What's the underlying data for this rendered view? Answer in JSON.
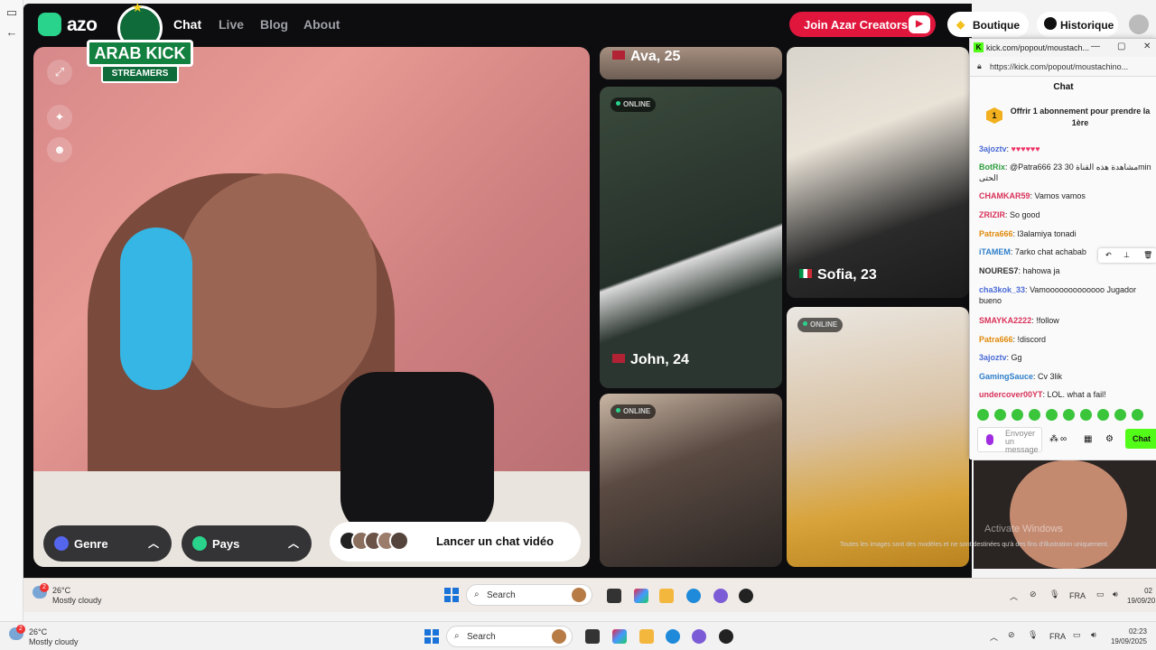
{
  "azar": {
    "logo_text": "azo",
    "nav": [
      "Chat",
      "Live",
      "Blog",
      "About"
    ],
    "join_creators": "Join Azar Creators",
    "boutique": "Boutique",
    "historique": "Historique",
    "watermark_line1": "ARAB KICK",
    "watermark_line2": "STREAMERS",
    "genre": "Genre",
    "pays": "Pays",
    "launch": "Lancer un chat vidéo",
    "online_label": "ONLINE",
    "cards": [
      {
        "name": "Ava, 25"
      },
      {
        "name": "John, 24"
      },
      {
        "name": "Sofia, 23"
      }
    ],
    "disclaimer": "Toutes les images sont des modèles et ne sont destinées qu'à des fins d'illustration uniquement."
  },
  "kick": {
    "window_title": "kick.com/popout/moustach...",
    "url": "https://kick.com/popout/moustachino...",
    "chat_title": "Chat",
    "sub_offer": "Offrir 1 abonnement pour prendre la 1ère",
    "sub_badge": "1",
    "messages": [
      {
        "user": "3ajoztv",
        "text": "",
        "color": "#4a6bd6"
      },
      {
        "user": "BotRix",
        "text": "@Patra666 23 مشاهدة هذه القناة 30min الحتى",
        "color": "#2e9e3e"
      },
      {
        "user": "CHAMKAR59",
        "text": "Vamos vamos",
        "color": "#d8325a"
      },
      {
        "user": "ZRIZIR",
        "text": "So good",
        "color": "#d8325a"
      },
      {
        "user": "Patra666",
        "text": "l3alamiya tonadi",
        "color": "#e08a0c"
      },
      {
        "user": "iTAMEM",
        "text": "7arko chat achabab",
        "color": "#2e7fc9"
      },
      {
        "user": "NOURES7",
        "text": "hahowa ja",
        "color": "#333333"
      },
      {
        "user": "cha3kok_33",
        "text": "Vamooooooooooooo Jugador bueno",
        "color": "#4a6bd6"
      },
      {
        "user": "SMAYKA2222",
        "text": "!follow",
        "color": "#d8325a"
      },
      {
        "user": "Patra666",
        "text": "!discord",
        "color": "#e08a0c"
      },
      {
        "user": "3ajoztv",
        "text": "Gg",
        "color": "#4a6bd6"
      },
      {
        "user": "GamingSauce",
        "text": "Cv 3lik",
        "color": "#2e7fc9"
      },
      {
        "user": "undercover00YT",
        "text": "LOL. what a fail!",
        "color": "#d8325a"
      }
    ],
    "input_placeholder": "Envoyer un message",
    "send": "Chat"
  },
  "mini_video_watermark": "Activate Windows",
  "taskbar_inner": {
    "temp": "26°C",
    "condition": "Mostly cloudy",
    "search": "Search",
    "lang": "FRA",
    "time": "02",
    "date": "19/09/20"
  },
  "taskbar_outer": {
    "temp": "26°C",
    "condition": "Mostly cloudy",
    "search": "Search",
    "lang": "FRA",
    "time": "02:23",
    "date": "19/09/2025"
  },
  "colors": {
    "azar_bg": "#0d0d0f",
    "creators_red": "#e0163d",
    "kick_green": "#53fc18",
    "azar_green": "#2ad38b"
  }
}
